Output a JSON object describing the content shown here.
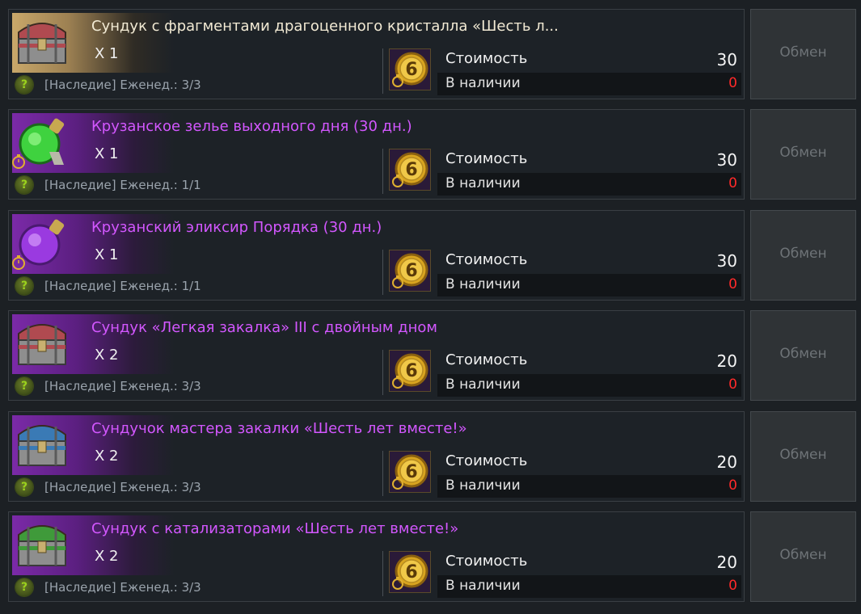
{
  "button_label": "Обмен",
  "cost_label": "Стоимость",
  "stock_label": "В наличии",
  "colors": {
    "purple_name": "#d357ff",
    "white_name": "#f2ead4",
    "stock_red": "#ff2a2a"
  },
  "items": [
    {
      "name": "Сундук с фрагментами драгоценного кристалла «Шесть л...",
      "qty": "X 1",
      "limit": "[Наследие] Еженед.: 3/3",
      "cost": "30",
      "stock": "0",
      "icon": "chest-icon",
      "theme": "gold"
    },
    {
      "name": "Крузанское зелье выходного дня (30 дн.)",
      "qty": "X 1",
      "limit": "[Наследие] Еженед.: 1/1",
      "cost": "30",
      "stock": "0",
      "icon": "potion-icon",
      "theme": "purple"
    },
    {
      "name": "Крузанский эликсир Порядка (30 дн.)",
      "qty": "X 1",
      "limit": "[Наследие] Еженед.: 1/1",
      "cost": "30",
      "stock": "0",
      "icon": "elixir-icon",
      "theme": "purple"
    },
    {
      "name": "Сундук «Легкая закалка» III с двойным дном",
      "qty": "X 2",
      "limit": "[Наследие] Еженед.: 3/3",
      "cost": "20",
      "stock": "0",
      "icon": "chest-icon",
      "theme": "purple"
    },
    {
      "name": "Сундучок мастера закалки «Шесть лет вместе!»",
      "qty": "X 2",
      "limit": "[Наследие] Еженед.: 3/3",
      "cost": "20",
      "stock": "0",
      "icon": "chest-icon",
      "theme": "purple"
    },
    {
      "name": "Сундук с катализаторами «Шесть лет вместе!»",
      "qty": "X 2",
      "limit": "[Наследие] Еженед.: 3/3",
      "cost": "20",
      "stock": "0",
      "icon": "chest-icon",
      "theme": "purple"
    }
  ]
}
